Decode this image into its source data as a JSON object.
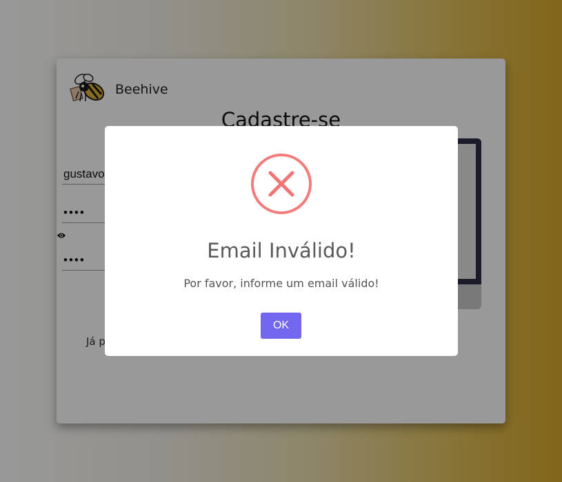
{
  "brand": {
    "name": "Beehive",
    "logo_icon": "bee-icon"
  },
  "page": {
    "title": "Cadastre-se",
    "name_value": "gustavo",
    "password_value": "••••",
    "confirm_value": "••••",
    "show_password_icon": "eye-icon",
    "login_prompt": "Já p"
  },
  "modal": {
    "icon": "error-x-icon",
    "title": "Email Inválido!",
    "text": "Por favor, informe um email válido!",
    "ok_label": "OK"
  },
  "colors": {
    "accent": "#7367f0",
    "error": "#f27474",
    "device_frame": "#2e2e48"
  }
}
